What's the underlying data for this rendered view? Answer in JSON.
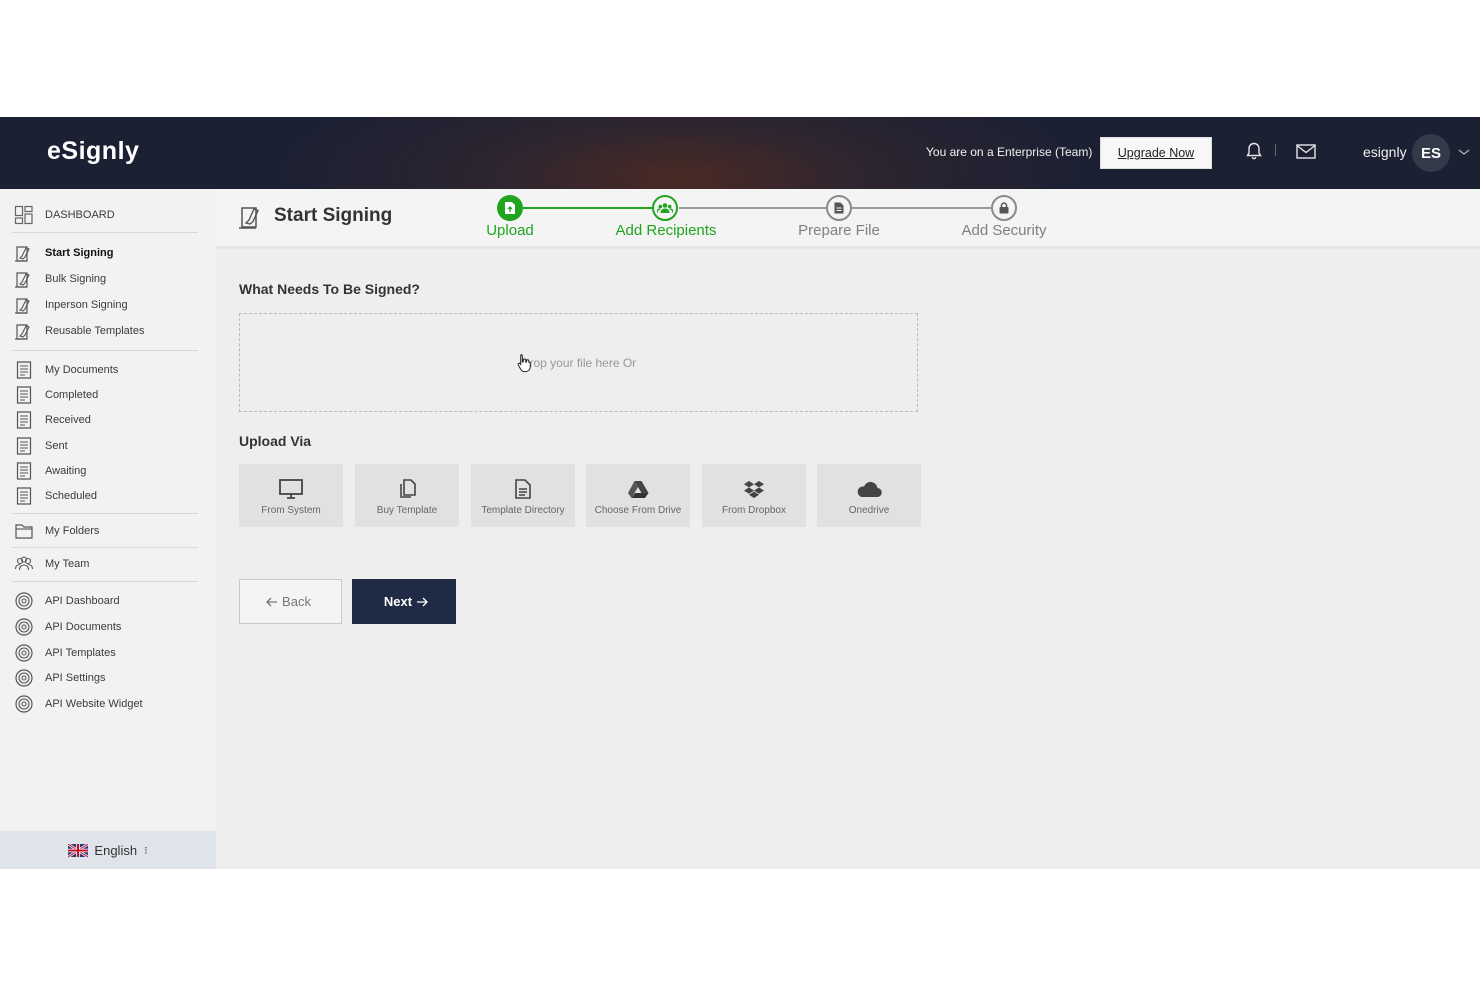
{
  "app": {
    "logo": "eSignly"
  },
  "topbar": {
    "plan_text": "You are on a Enterprise (Team)",
    "upgrade_label": "Upgrade Now",
    "username": "esignly",
    "avatar_initials": "ES"
  },
  "sidebar": {
    "dashboard": "DASHBOARD",
    "signing": [
      "Start Signing",
      "Bulk Signing",
      "Inperson Signing",
      "Reusable Templates"
    ],
    "documents": [
      "My Documents",
      "Completed",
      "Received",
      "Sent",
      "Awaiting",
      "Scheduled"
    ],
    "folders": "My Folders",
    "team": "My Team",
    "api": [
      "API Dashboard",
      "API Documents",
      "API Templates",
      "API Settings",
      "API Website Widget"
    ],
    "language": "English"
  },
  "main": {
    "page_title": "Start Signing",
    "steps": [
      {
        "label": "Upload",
        "state": "active"
      },
      {
        "label": "Add Recipients",
        "state": "active"
      },
      {
        "label": "Prepare File",
        "state": "inactive"
      },
      {
        "label": "Add Security",
        "state": "inactive"
      }
    ],
    "question": "What Needs To Be Signed?",
    "dropzone_text": "Drop your file here Or",
    "upload_via": "Upload Via",
    "upload_options": [
      "From System",
      "Buy Template",
      "Template Directory",
      "Choose From Drive",
      "From Dropbox",
      "Onedrive"
    ],
    "back_label": "Back",
    "next_label": "Next"
  },
  "colors": {
    "topbar": "#1b2033",
    "accent_green": "#1fa51f",
    "next_button": "#1f2a44",
    "inactive_step": "#808080"
  }
}
